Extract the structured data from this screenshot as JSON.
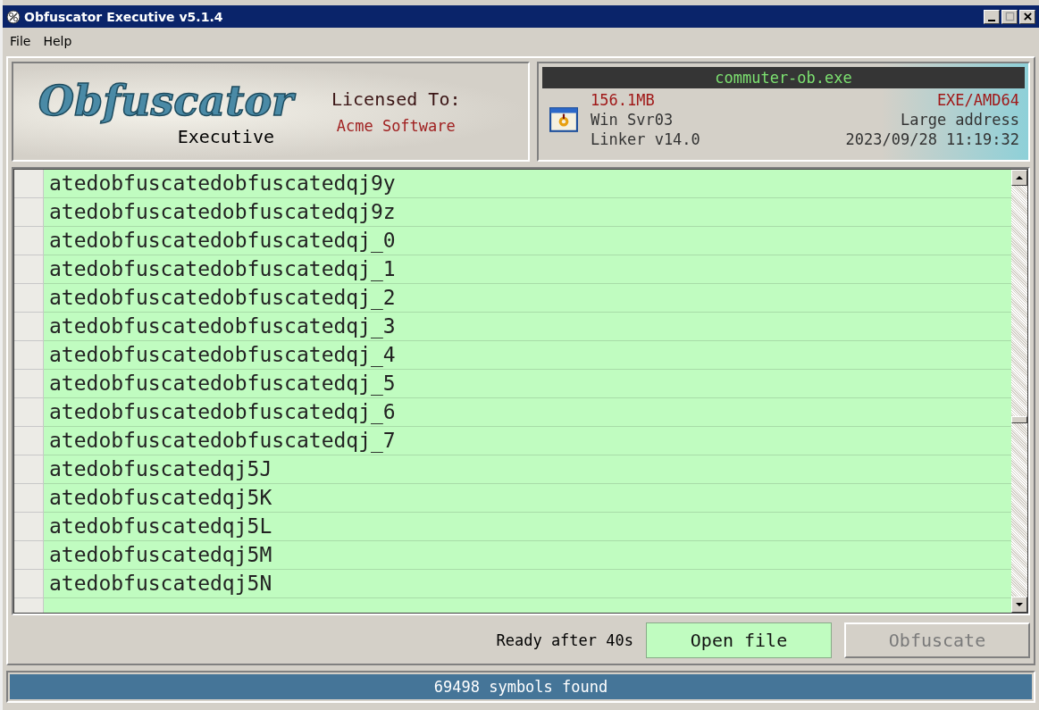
{
  "window": {
    "title": "Obfuscator Executive v5.1.4"
  },
  "menu": [
    "File",
    "Help"
  ],
  "logo": {
    "title": "Obfuscator",
    "subtitle": "Executive"
  },
  "license": {
    "label": "Licensed To:",
    "name": "Acme Software"
  },
  "file_info": {
    "name": "commuter-ob.exe",
    "size": "156.1MB",
    "os": "Win Svr03",
    "linker": "Linker v14.0",
    "type": "EXE/AMD64",
    "flags": "Large address",
    "timestamp": "2023/09/28 11:19:32"
  },
  "symbols": [
    {
      "name": "atedobfuscatedobfuscatedqj9y"
    },
    {
      "name": "atedobfuscatedobfuscatedqj9z"
    },
    {
      "name": "atedobfuscatedobfuscatedqj_0"
    },
    {
      "name": "atedobfuscatedobfuscatedqj_1"
    },
    {
      "name": "atedobfuscatedobfuscatedqj_2"
    },
    {
      "name": "atedobfuscatedobfuscatedqj_3"
    },
    {
      "name": "atedobfuscatedobfuscatedqj_4"
    },
    {
      "name": "atedobfuscatedobfuscatedqj_5"
    },
    {
      "name": "atedobfuscatedobfuscatedqj_6"
    },
    {
      "name": "atedobfuscatedobfuscatedqj_7"
    },
    {
      "name": "atedobfuscatedqj5J"
    },
    {
      "name": "atedobfuscatedqj5K"
    },
    {
      "name": "atedobfuscatedqj5L"
    },
    {
      "name": "atedobfuscatedqj5M"
    },
    {
      "name": "atedobfuscatedqj5N"
    }
  ],
  "status_text": "Ready after 40s",
  "buttons": [
    {
      "label": "Open file",
      "disabled": false
    },
    {
      "label": "Obfuscate",
      "disabled": true
    }
  ],
  "status_bar": "69498 symbols found"
}
